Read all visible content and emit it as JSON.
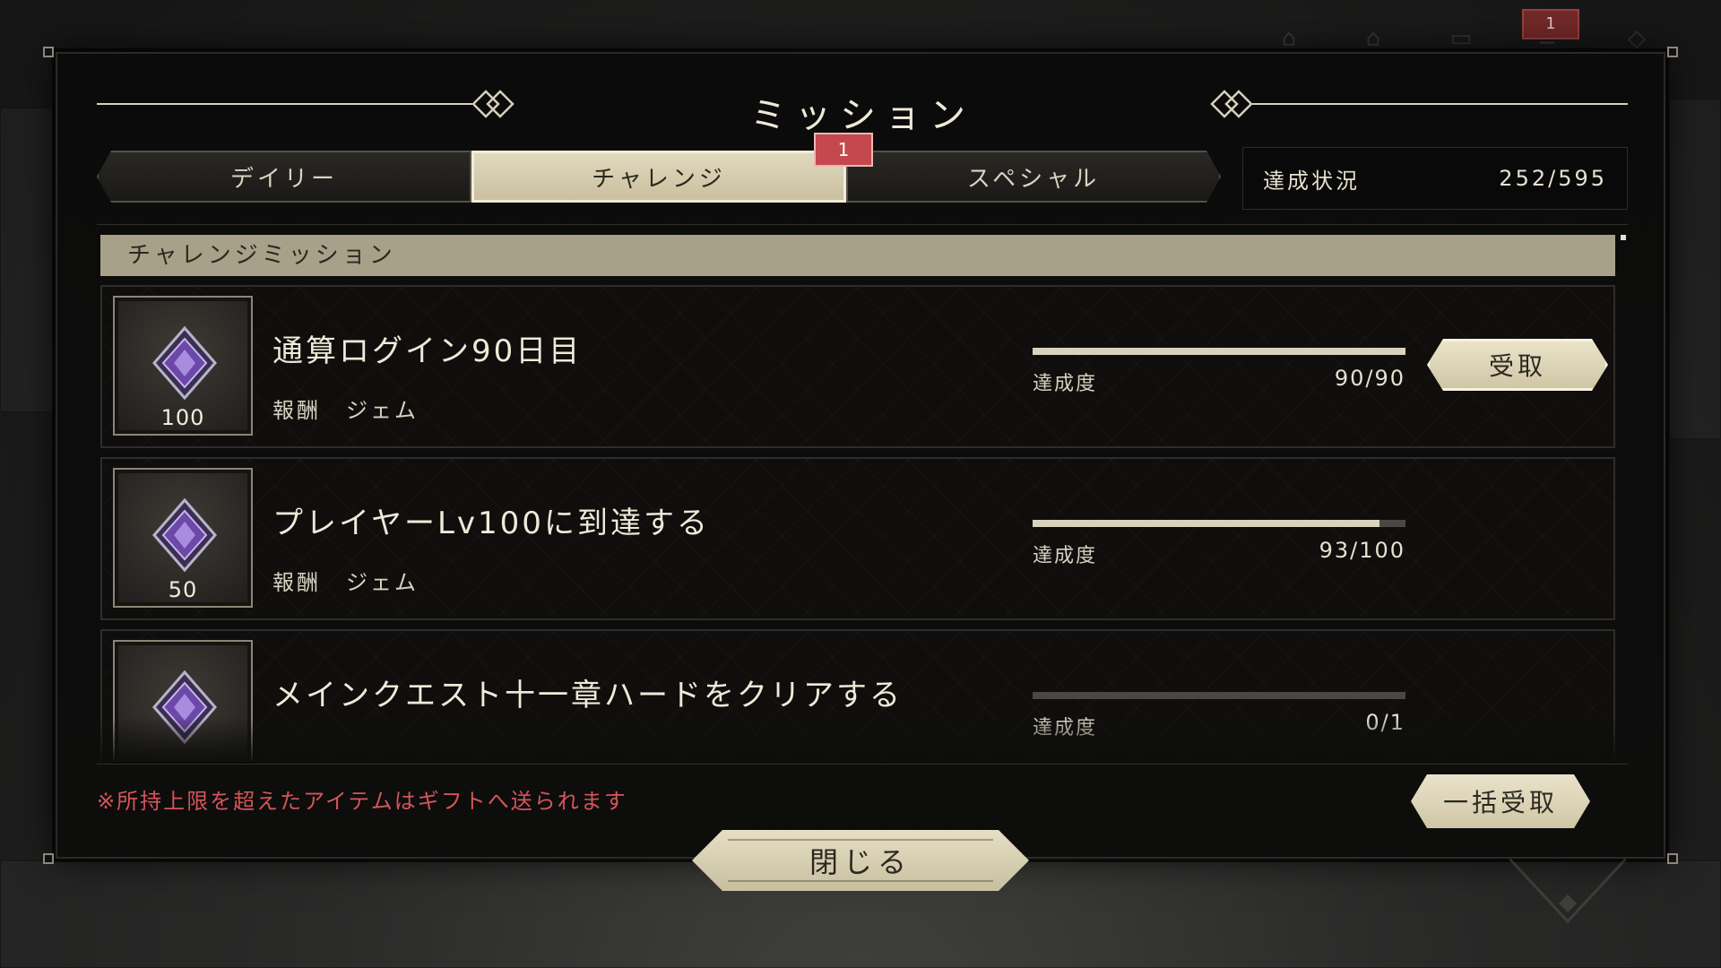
{
  "hud": {
    "notification_count": "1"
  },
  "title": "ミッション",
  "tabs": [
    {
      "label": "デイリー",
      "active": false
    },
    {
      "label": "チャレンジ",
      "active": true,
      "badge": "1"
    },
    {
      "label": "スペシャル",
      "active": false
    }
  ],
  "status": {
    "label": "達成状況",
    "value": "252/595"
  },
  "section_title": "チャレンジミッション",
  "missions": [
    {
      "name": "通算ログイン90日目",
      "reward_label": "報酬",
      "reward_item": "ジェム",
      "reward_qty": "100",
      "reward_icon": "gem-icon",
      "progress_label": "達成度",
      "progress_value": "90/90",
      "progress_fraction": 1.0,
      "claim_label": "受取"
    },
    {
      "name": "プレイヤーLv100に到達する",
      "reward_label": "報酬",
      "reward_item": "ジェム",
      "reward_qty": "50",
      "reward_icon": "gem-icon",
      "progress_label": "達成度",
      "progress_value": "93/100",
      "progress_fraction": 0.93
    },
    {
      "name": "メインクエスト十一章ハードをクリアする",
      "reward_icon": "gem-icon",
      "progress_label": "達成度",
      "progress_value": "0/1",
      "progress_fraction": 0.0
    }
  ],
  "footer": {
    "note": "※所持上限を超えたアイテムはギフトへ送られます",
    "bulk_claim_label": "一括受取",
    "close_label": "閉じる"
  },
  "colors": {
    "accent": "#d9d2bd",
    "badge": "#c4484d",
    "note_text": "#d3555a",
    "gem_purple": "#8a5cc7"
  }
}
